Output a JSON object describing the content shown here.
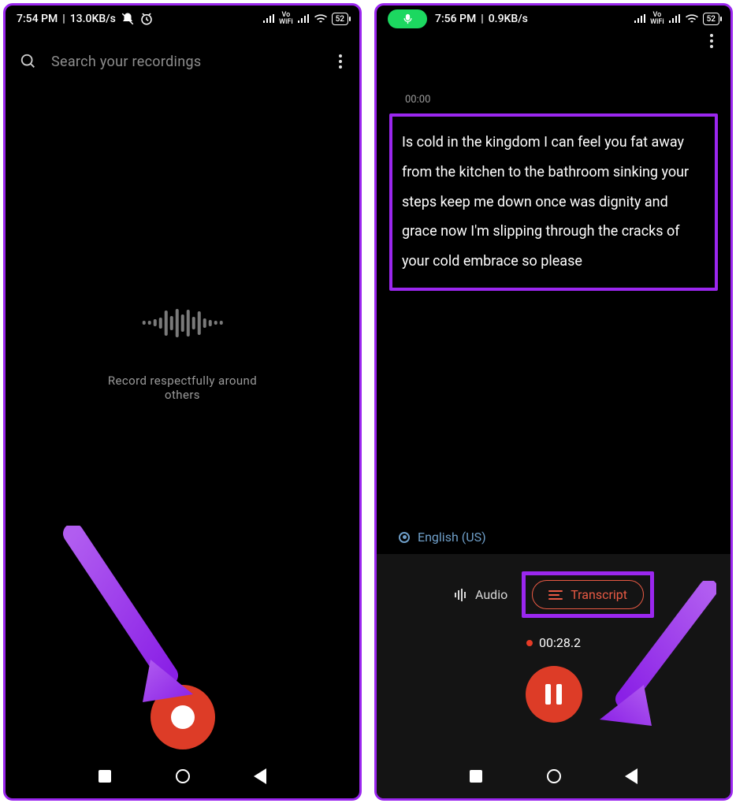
{
  "left": {
    "status": {
      "time": "7:54 PM",
      "speed": "13.0KB/s",
      "battery": "52",
      "vowifi": "Vo\nWiFi"
    },
    "search_placeholder": "Search your recordings",
    "empty_text": "Record respectfully around others"
  },
  "right": {
    "status": {
      "time": "7:56 PM",
      "speed": "0.9KB/s",
      "battery": "52",
      "vowifi": "Vo\nWiFi"
    },
    "timestamp": "00:00",
    "transcript": "Is cold in the kingdom I can feel you fat away from the kitchen to the bathroom sinking your steps keep me down once was dignity and grace now I'm slipping through the cracks of your cold embrace so please",
    "language": "English (US)",
    "audio_label": "Audio",
    "transcript_label": "Transcript",
    "rec_time": "00:28.2"
  }
}
